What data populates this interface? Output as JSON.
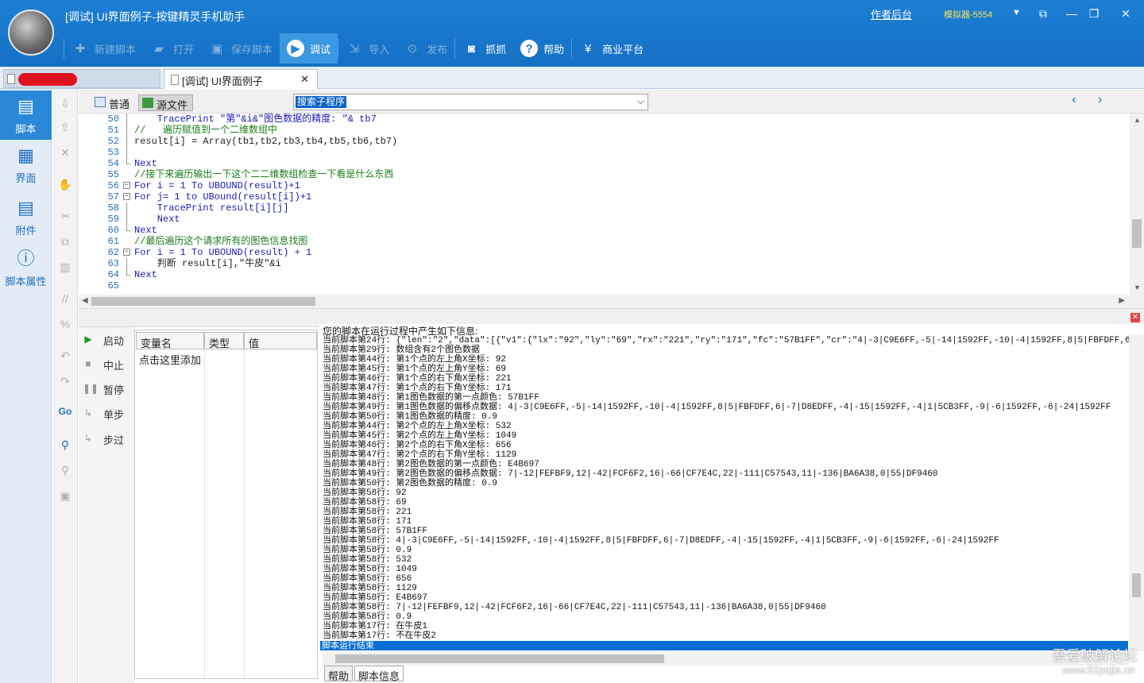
{
  "window": {
    "title": "[调试] UI界面例子-按键精灵手机助手",
    "link_admin": "作者后台",
    "emulator": "模拟器-5554"
  },
  "toolbar": {
    "new_script": "新建脚本",
    "open": "打开",
    "save_script": "保存脚本",
    "debug": "调试",
    "import": "导入",
    "publish": "发布",
    "capture": "抓抓",
    "help": "帮助",
    "business": "商业平台"
  },
  "tabs": {
    "active_tab": "[调试] UI界面例子"
  },
  "sidebar": {
    "items": [
      {
        "label": "脚本",
        "icon": "script-icon"
      },
      {
        "label": "界面",
        "icon": "layout-icon"
      },
      {
        "label": "附件",
        "icon": "attachment-icon"
      },
      {
        "label": "脚本属性",
        "icon": "info-icon"
      }
    ]
  },
  "editor": {
    "mode_normal": "普通",
    "mode_source": "源文件",
    "function_combo": "搜索子程序",
    "lines": [
      {
        "n": "50",
        "text": "    TracePrint \"第\"&i&\"图色数据的精度: \"& tb7"
      },
      {
        "n": "51",
        "text": "//   遍历赋值到一个二维数组中"
      },
      {
        "n": "52",
        "text": "result[i] = Array(tb1,tb2,tb3,tb4,tb5,tb6,tb7)"
      },
      {
        "n": "53",
        "text": ""
      },
      {
        "n": "54",
        "text": "Next"
      },
      {
        "n": "55",
        "text": "//接下来遍历输出一下这个二二维数组检查一下看是什么东西"
      },
      {
        "n": "56",
        "text": "For i = 1 To UBOUND(result)+1"
      },
      {
        "n": "57",
        "text": "For j= 1 to UBound(result[i])+1"
      },
      {
        "n": "58",
        "text": "    TracePrint result[i][j]"
      },
      {
        "n": "59",
        "text": "    Next"
      },
      {
        "n": "60",
        "text": "Next"
      },
      {
        "n": "61",
        "text": "//最后遍历这个请求所有的图色信息找图"
      },
      {
        "n": "62",
        "text": "For i = 1 To UBOUND(result) + 1"
      },
      {
        "n": "63",
        "text": "    判断 result[i],\"牛皮\"&i"
      },
      {
        "n": "64",
        "text": "Next"
      },
      {
        "n": "65",
        "text": ""
      }
    ]
  },
  "debug_controls": {
    "start": "启动",
    "stop": "中止",
    "pause": "暂停",
    "step": "单步",
    "step_over": "步过"
  },
  "variables": {
    "col_name": "变量名",
    "col_type": "类型",
    "col_value": "值",
    "add_hint": "点击这里添加"
  },
  "output": {
    "header": "您的脚本在运行过程中产生如下信息:",
    "lines": [
      "当前脚本第24行: {\"len\":\"2\",\"data\":[{\"v1\":{\"lx\":\"92\",\"ly\":\"69\",\"rx\":\"221\",\"ry\":\"171\",\"fc\":\"57B1FF\",\"cr\":\"4|-3|C9E6FF,-5|-14|1592FF,-10|-4|1592FF,8|5|FBFDFF,6|-7|D8EDFF,-4|",
      "当前脚本第29行: 数组含有2个图色数据",
      "当前脚本第44行: 第1个点的左上角X坐标: 92",
      "当前脚本第45行: 第1个点的左上角Y坐标: 69",
      "当前脚本第46行: 第1个点的右下角X坐标: 221",
      "当前脚本第47行: 第1个点的右下角Y坐标: 171",
      "当前脚本第48行: 第1图色数据的第一点颜色: 57B1FF",
      "当前脚本第49行: 第1图色数据的偏移点数据: 4|-3|C9E6FF,-5|-14|1592FF,-10|-4|1592FF,8|5|FBFDFF,6|-7|D8EDFF,-4|-15|1592FF,-4|1|5CB3FF,-9|-6|1592FF,-6|-24|1592FF",
      "当前脚本第50行: 第1图色数据的精度: 0.9",
      "当前脚本第44行: 第2个点的左上角X坐标: 532",
      "当前脚本第45行: 第2个点的左上角Y坐标: 1049",
      "当前脚本第46行: 第2个点的右下角X坐标: 656",
      "当前脚本第47行: 第2个点的右下角Y坐标: 1129",
      "当前脚本第48行: 第2图色数据的第一点颜色: E4B697",
      "当前脚本第49行: 第2图色数据的偏移点数据: 7|-12|FEFBF9,12|-42|FCF6F2,16|-66|CF7E4C,22|-111|C57543,11|-136|BA6A38,0|55|DF9460",
      "当前脚本第50行: 第2图色数据的精度: 0.9",
      "当前脚本第58行: 92",
      "当前脚本第58行: 69",
      "当前脚本第58行: 221",
      "当前脚本第58行: 171",
      "当前脚本第58行: 57B1FF",
      "当前脚本第58行: 4|-3|C9E6FF,-5|-14|1592FF,-10|-4|1592FF,8|5|FBFDFF,6|-7|D8EDFF,-4|-15|1592FF,-4|1|5CB3FF,-9|-6|1592FF,-6|-24|1592FF",
      "当前脚本第58行: 0.9",
      "当前脚本第58行: 532",
      "当前脚本第58行: 1049",
      "当前脚本第58行: 656",
      "当前脚本第58行: 1129",
      "当前脚本第58行: E4B697",
      "当前脚本第58行: 7|-12|FEFBF9,12|-42|FCF6F2,16|-66|CF7E4C,22|-111|C57543,11|-136|BA6A38,0|55|DF9460",
      "当前脚本第58行: 0.9",
      "当前脚本第17行: 在牛皮1",
      "当前脚本第17行: 不在牛皮2"
    ],
    "end": "脚本运行结束"
  },
  "bottom_tabs": {
    "help": "帮助",
    "script_info": "脚本信息"
  },
  "watermark": {
    "line1": "吾爱破解论坛",
    "line2": "www.52pojie.cn"
  },
  "colors": {
    "accent": "#1c7fd4",
    "selection": "#0b6fd3",
    "keyword": "#1a1ab3",
    "comment": "#1a7c1a"
  }
}
